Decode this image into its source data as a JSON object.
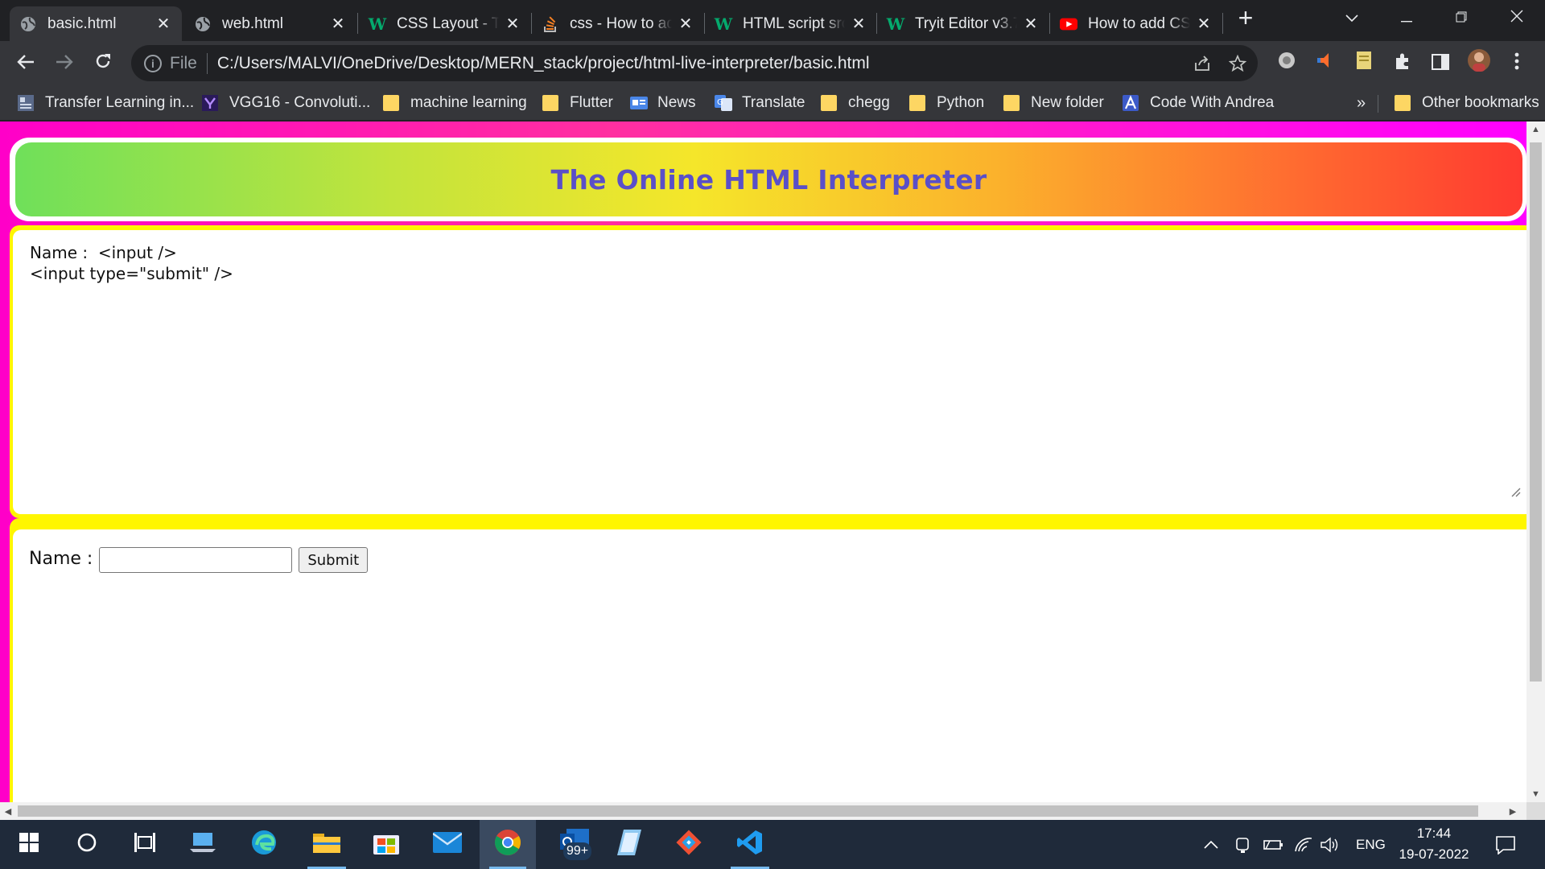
{
  "browser": {
    "tabs": [
      {
        "title": "basic.html",
        "icon": "globe-icon",
        "active": true
      },
      {
        "title": "web.html",
        "icon": "globe-icon",
        "active": false
      },
      {
        "title": "CSS Layout - The",
        "icon": "w3schools-icon",
        "active": false
      },
      {
        "title": "css - How to add",
        "icon": "stackoverflow-icon",
        "active": false
      },
      {
        "title": "HTML script src",
        "icon": "w3schools-icon",
        "active": false
      },
      {
        "title": "Tryit Editor v3.7",
        "icon": "w3schools-icon",
        "active": false
      },
      {
        "title": "How to add CSS",
        "icon": "youtube-icon",
        "active": false
      }
    ],
    "new_tab_symbol": "+",
    "close_symbol": "✕",
    "address": {
      "scheme_label": "File",
      "url": "C:/Users/MALVI/OneDrive/Desktop/MERN_stack/project/html-live-interpreter/basic.html"
    },
    "bookmarks": [
      {
        "label": "Transfer Learning in...",
        "icon": "page-icon"
      },
      {
        "label": "VGG16 - Convoluti...",
        "icon": "vgg-icon"
      },
      {
        "label": "machine learning",
        "icon": "folder-icon"
      },
      {
        "label": "Flutter",
        "icon": "folder-icon"
      },
      {
        "label": "News",
        "icon": "google-news-icon"
      },
      {
        "label": "Translate",
        "icon": "google-translate-icon"
      },
      {
        "label": "chegg",
        "icon": "folder-icon"
      },
      {
        "label": "Python",
        "icon": "folder-icon"
      },
      {
        "label": "New folder",
        "icon": "folder-icon"
      },
      {
        "label": "Code With Andrea",
        "icon": "andrea-icon"
      }
    ],
    "bookmarks_overflow": "»",
    "other_bookmarks": "Other bookmarks"
  },
  "page": {
    "title": "The Online HTML Interpreter",
    "editor_code": "Name :  <input />\n<input type=\"submit\" />",
    "output": {
      "label": "Name :",
      "input_value": "",
      "submit_label": "Submit"
    }
  },
  "taskbar": {
    "apps": [
      {
        "name": "start-button",
        "icon": "windows-icon"
      },
      {
        "name": "search-button",
        "icon": "cortana-circle-icon"
      },
      {
        "name": "task-view-button",
        "icon": "task-view-icon"
      },
      {
        "name": "app-laptop",
        "icon": "laptop-icon"
      },
      {
        "name": "app-edge",
        "icon": "edge-icon"
      },
      {
        "name": "app-file-explorer",
        "icon": "folder-icon"
      },
      {
        "name": "app-store",
        "icon": "store-icon"
      },
      {
        "name": "app-mail",
        "icon": "mail-icon"
      },
      {
        "name": "app-chrome",
        "icon": "chrome-icon"
      },
      {
        "name": "app-outlook",
        "icon": "outlook-icon"
      },
      {
        "name": "app-notepad",
        "icon": "notepad-icon"
      },
      {
        "name": "app-git",
        "icon": "git-icon"
      },
      {
        "name": "app-vscode",
        "icon": "vscode-icon"
      }
    ],
    "badge": "99+",
    "language": "ENG",
    "time": "17:44",
    "date": "19-07-2022"
  },
  "colors": {
    "browser_dark": "#202124",
    "toolbar": "#35363a",
    "page_border": "#ff00c8",
    "editor_border": "#fff600",
    "title_text": "#5a4fc8",
    "taskbar": "#1f2a3a"
  }
}
